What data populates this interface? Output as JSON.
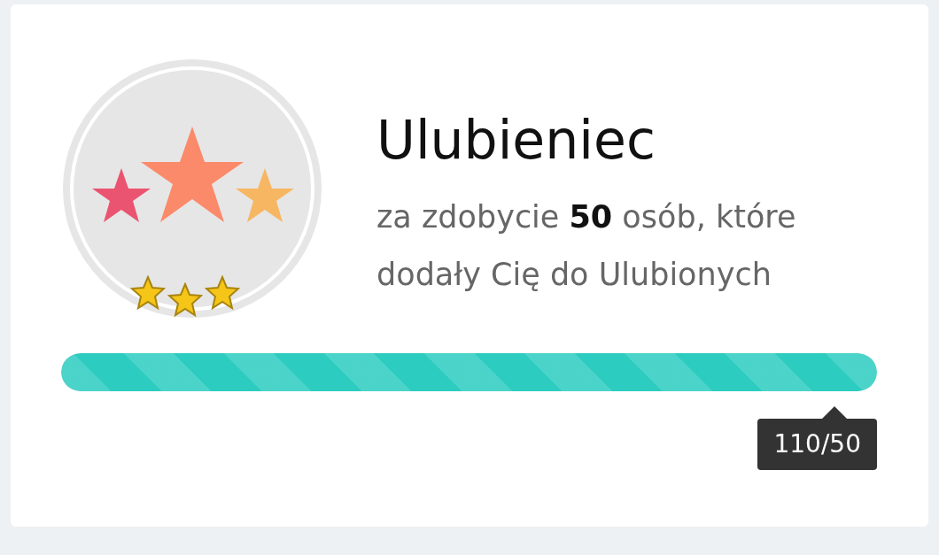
{
  "badge": {
    "stars": 3
  },
  "title": "Ulubieniec",
  "description": "za zdobycie **50** osób, które dodały Cię do Ulubionych",
  "progress": {
    "level": 1,
    "reading": "110/50"
  }
}
